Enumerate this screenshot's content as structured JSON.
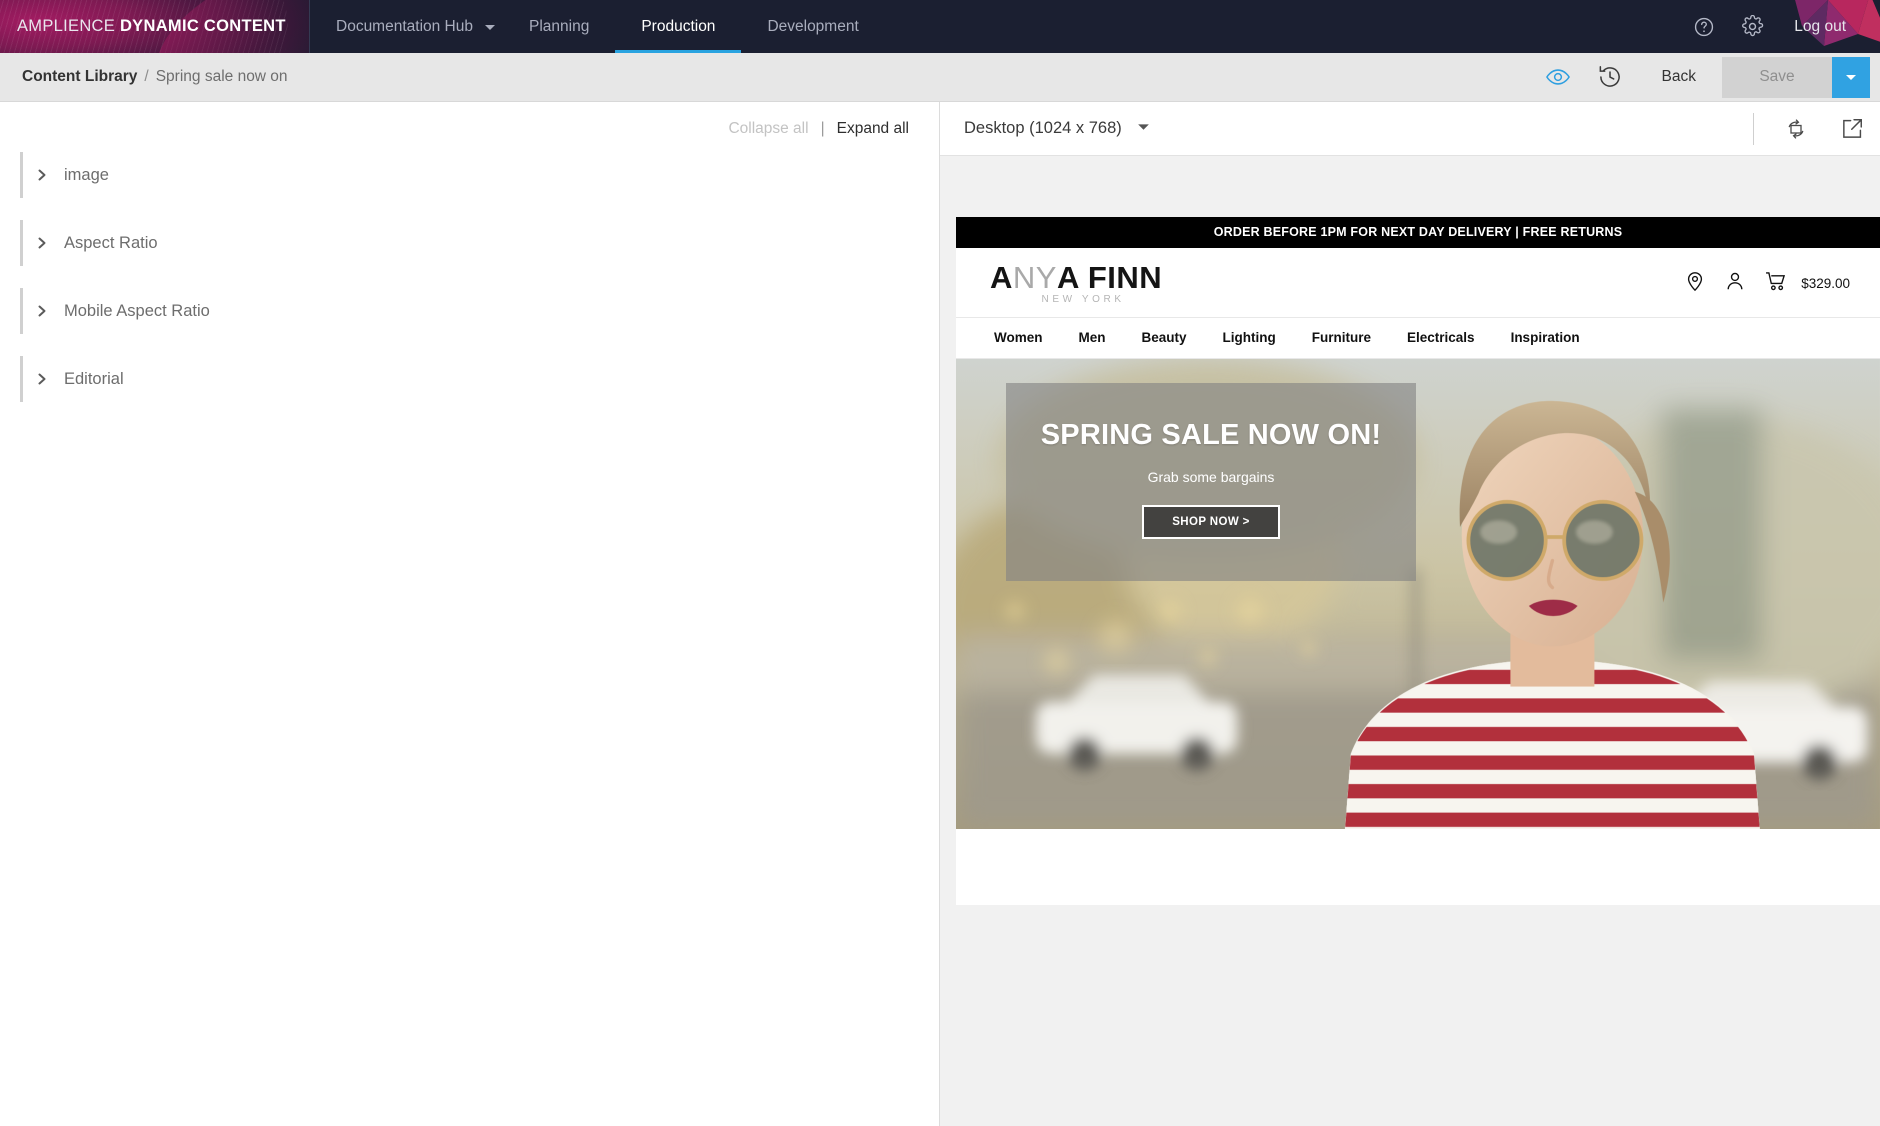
{
  "topnav": {
    "brand_light": "AMPLIENCE",
    "brand_bold": "DYNAMIC CONTENT",
    "items": [
      {
        "label": "Documentation Hub",
        "active": false,
        "has_caret": true
      },
      {
        "label": "Planning",
        "active": false,
        "has_caret": false
      },
      {
        "label": "Production",
        "active": true,
        "has_caret": false
      },
      {
        "label": "Development",
        "active": false,
        "has_caret": false
      }
    ],
    "help_icon": "help-circle-icon",
    "settings_icon": "gear-icon",
    "logout_label": "Log out",
    "accent_color": "#29a3e0",
    "background_color": "#1b1f31"
  },
  "breadcrumb": {
    "root": "Content Library",
    "separator": "/",
    "leaf": "Spring sale now on"
  },
  "actionbar": {
    "preview_icon": "eye-icon",
    "history_icon": "history-clock-icon",
    "back_label": "Back",
    "save_label": "Save",
    "save_enabled": false,
    "save_dropdown_icon": "chevron-down-icon",
    "save_dropdown_color": "#30a2e2"
  },
  "editor": {
    "collapse_all_label": "Collapse all",
    "pipe": "|",
    "expand_all_label": "Expand all",
    "collapse_all_enabled": false,
    "tree": [
      {
        "label": "image",
        "expanded": false
      },
      {
        "label": "Aspect Ratio",
        "expanded": false
      },
      {
        "label": "Mobile Aspect Ratio",
        "expanded": false
      },
      {
        "label": "Editorial",
        "expanded": false
      }
    ]
  },
  "preview": {
    "device_label": "Desktop (1024 x 768)",
    "device_caret_icon": "chevron-down-icon",
    "rotate_icon": "rotate-device-icon",
    "open_new_icon": "open-in-new-icon"
  },
  "site": {
    "promo_bar": "ORDER BEFORE 1PM FOR NEXT DAY DELIVERY | FREE RETURNS",
    "logo": {
      "part_a": "A",
      "part_dim": "NY",
      "part_b": "A FINN",
      "subtitle": "NEW YORK"
    },
    "header_icons": [
      {
        "name": "location-pin-icon"
      },
      {
        "name": "user-account-icon"
      },
      {
        "name": "shopping-cart-icon"
      }
    ],
    "cart_total": "$329.00",
    "nav": [
      "Women",
      "Men",
      "Beauty",
      "Lighting",
      "Furniture",
      "Electricals",
      "Inspiration"
    ],
    "hero": {
      "title": "SPRING SALE NOW ON!",
      "subtitle": "Grab some bargains",
      "cta_label": "SHOP NOW >"
    }
  }
}
